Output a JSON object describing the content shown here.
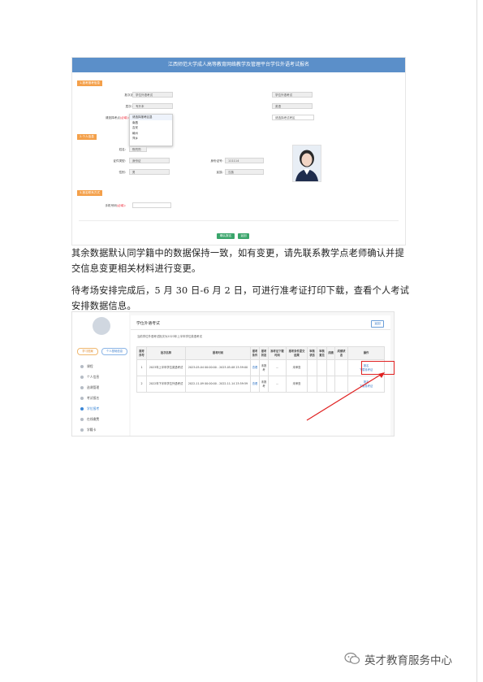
{
  "form": {
    "title": "江西师范大学成人高等教育网络教学及管理平台学位外语考试报名",
    "sections": {
      "exam": "1.报考报考信息",
      "personal": "2.个人信息",
      "contact": "3.报名联系方式"
    },
    "fields": {
      "batch_name_label": "批次名称:",
      "batch_name_value": "学位外语考试",
      "batch_type_label": "批次类型:",
      "batch_type_value": "学位外语考试",
      "level_label": "层次:",
      "level_value": "专升本",
      "major_label": "报考专业:",
      "major_value": "英语",
      "exam_area_label": "请选择考点",
      "exam_area_req": "(必填):",
      "exam_area_value": "请选择考试考区",
      "exam_area2_label": "请选择报考城市:",
      "exam_area2_value": "请选择考试考区",
      "name_label": "姓名:",
      "name_value": "陈同同",
      "idtype_label": "证件类型:",
      "idtype_value": "身份证",
      "idnum_label": "身份证号:",
      "idnum_value": "111114",
      "gender_label": "性别:",
      "gender_value": "男",
      "ethnicity_label": "民族:",
      "ethnicity_value": "汉族",
      "phone_label": "手机号码",
      "phone_req": "(必填):"
    },
    "dropdown_options": [
      "请选择报考区县",
      "南昌",
      "吉安",
      "赣州",
      "萍乡"
    ],
    "buttons": {
      "confirm": "确认报名",
      "back": "返回"
    }
  },
  "paragraphs": {
    "p1": "其余数据默认同学籍中的数据保持一致，如有变更，请先联系教学点老师确认并提交信息变更相关材料进行变更。",
    "p2": "待考场安排完成后，5 月 30 日-6 月 2 日，可进行准考证打印下载，查看个人考试安排数据信息。"
  },
  "portal": {
    "pills": [
      "学习档案",
      "个人基础信息"
    ],
    "nav": [
      "课程",
      "个人信息",
      "选课管理",
      "考试报名",
      "学位报考",
      "在线缴费",
      "学籍卡"
    ],
    "active_nav": 4,
    "title": "学位外语考试",
    "back": "返回",
    "note": "当前学位外语考试批次为2023年上半年学位英语考试",
    "columns": [
      "报考序号",
      "批次名称",
      "报考时间",
      "报考条件",
      "报考状态",
      "准考证下载时间",
      "报考条件提交结果",
      "审核状态",
      "审核意见",
      "成绩",
      "成绩状态",
      "操作"
    ],
    "rows": [
      {
        "no": "1",
        "batch": "2023年上半年学位英语考试",
        "time": "2023-05-04 00:00:00 - 2023-05-08 23:59:00",
        "cond": "查看",
        "status": "未报考",
        "ticket": "--",
        "result": "未审查",
        "audit": "",
        "opinion": "",
        "score": "",
        "score_status": "",
        "ops": [
          "报名",
          "下载准考证"
        ]
      },
      {
        "no": "2",
        "batch": "2022年下半年学位外语考试",
        "time": "2022-11-09 00:00:00 - 2022-11-14 23:59:59",
        "cond": "查看",
        "status": "未报考",
        "ticket": "--",
        "result": "未审查",
        "audit": "",
        "opinion": "",
        "score": "",
        "score_status": "",
        "ops": [
          "报名",
          "下载准考证"
        ]
      }
    ]
  },
  "watermark": "英才教育服务中心",
  "colors": {
    "header_blue": "#5b8fc9",
    "section_orange": "#f4a04a",
    "confirm_green": "#3aa56b",
    "highlight_red": "#e02020"
  }
}
